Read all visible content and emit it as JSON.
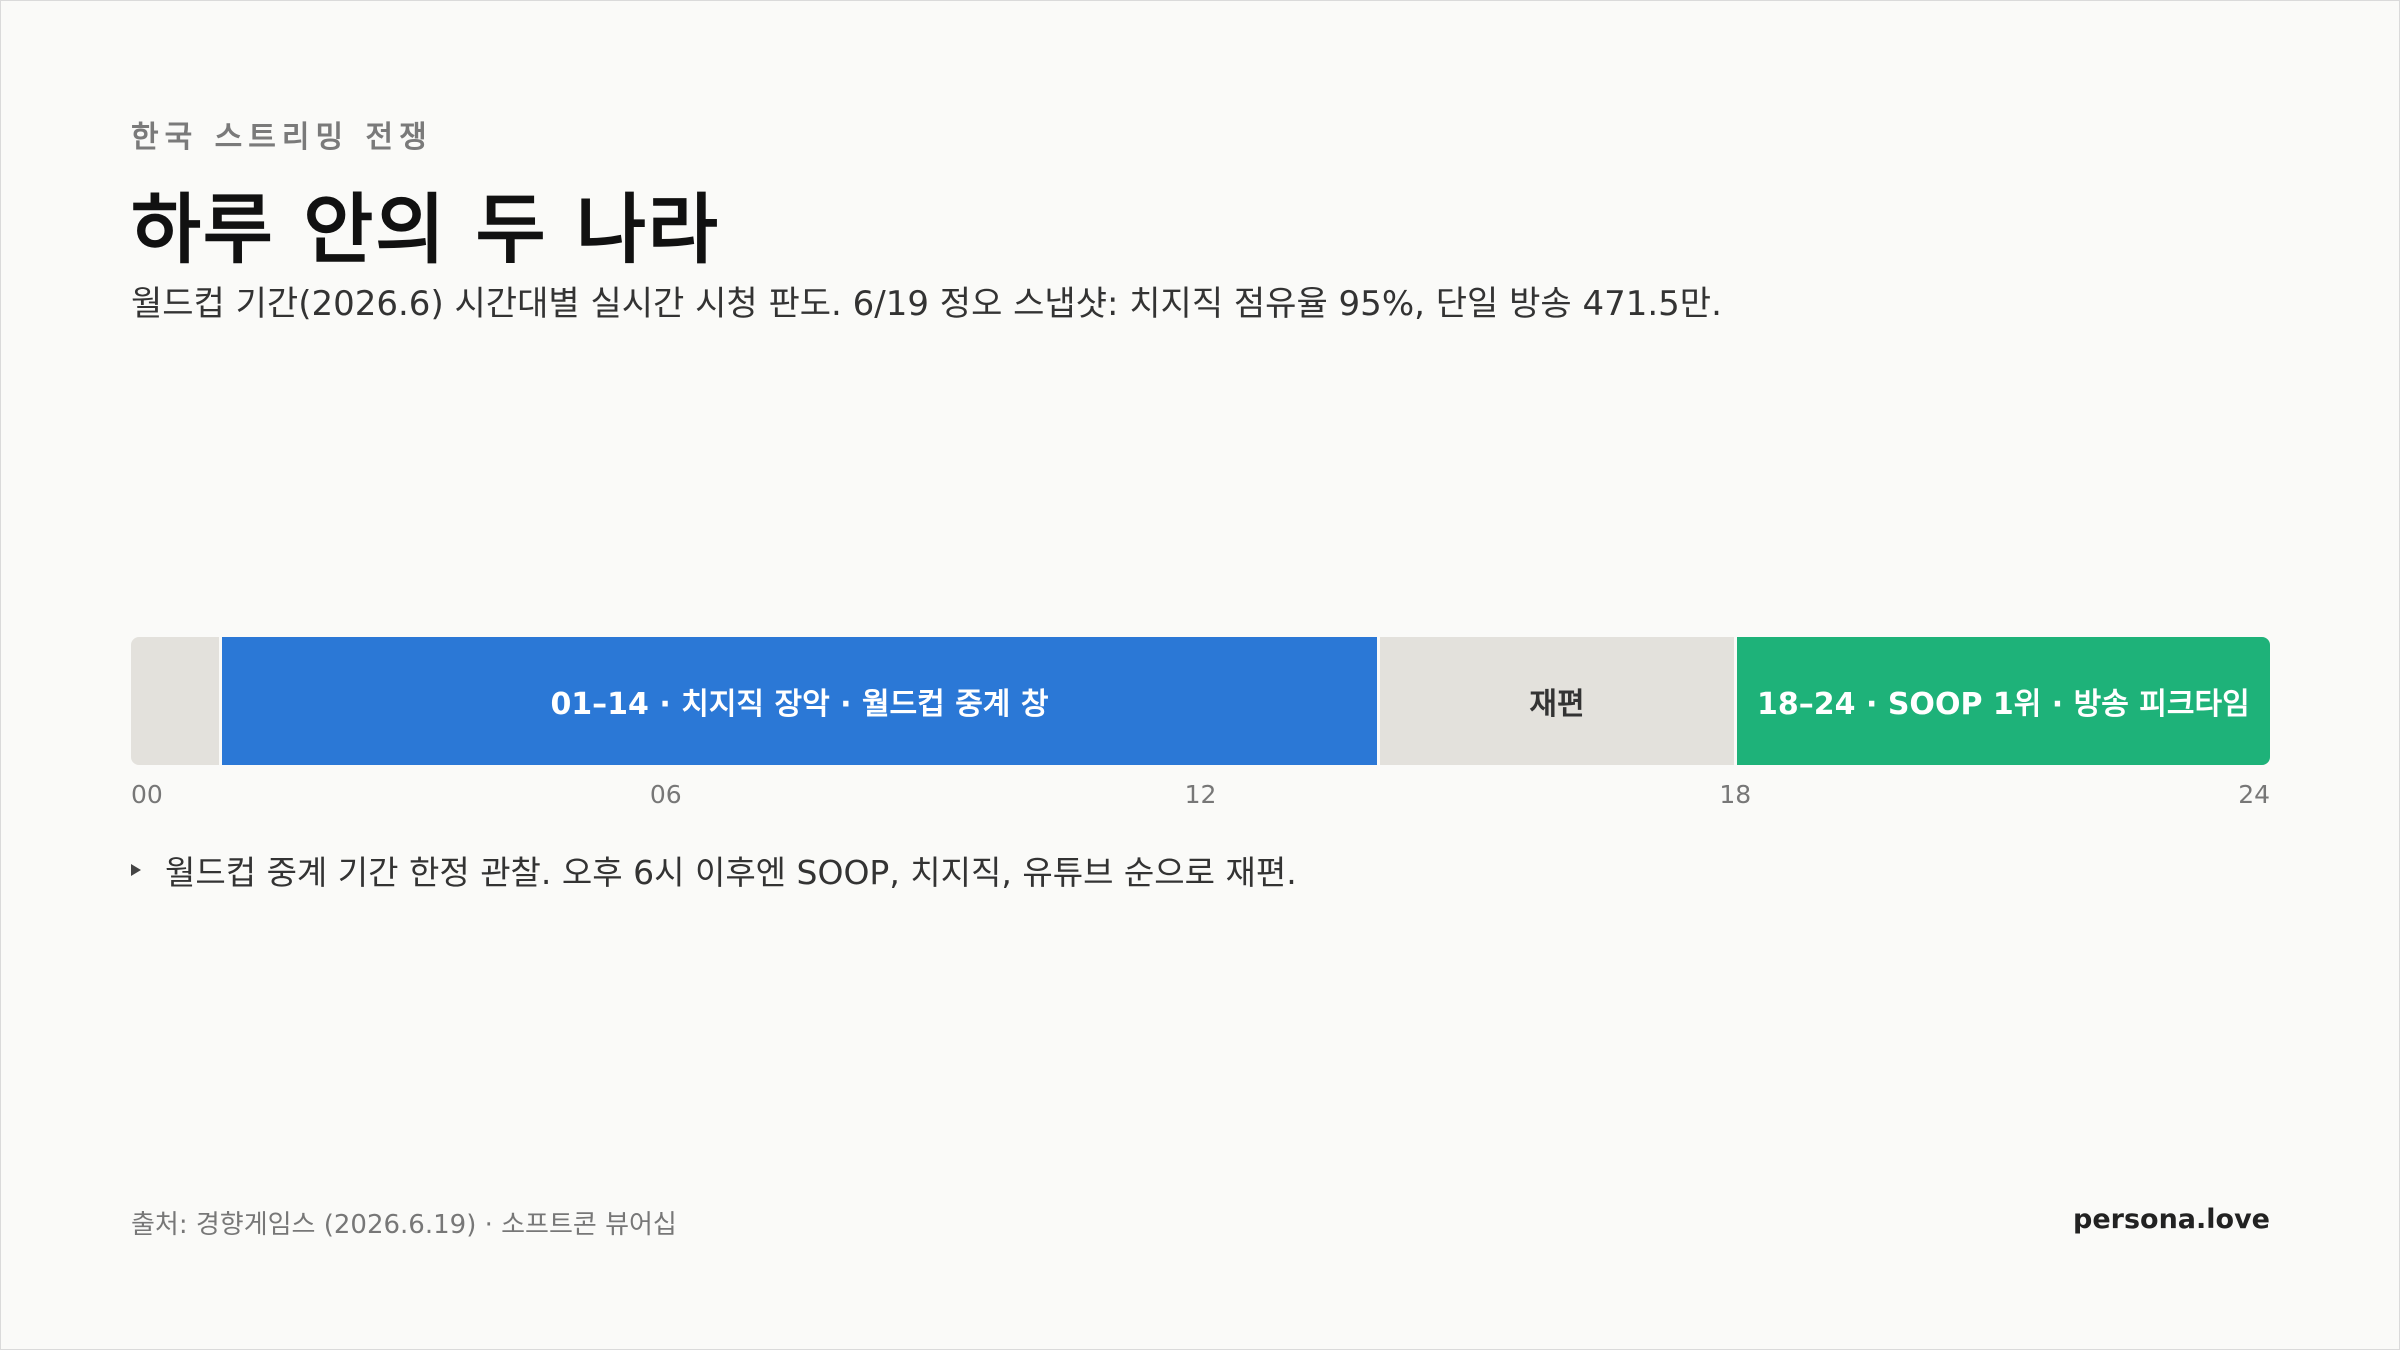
{
  "eyebrow": "한국 스트리밍 전쟁",
  "title": "하루 안의 두 나라",
  "subtitle": "월드컵 기간(2026.6) 시간대별 실시간 시청 판도. 6/19 정오 스냅샷: 치지직 점유율 95%, 단일 방송 471.5만.",
  "note": "월드컵 중계 기간 한정 관찰. 오후 6시 이후엔 SOOP, 치지직, 유튜브 순으로 재편.",
  "source": "출처: 경향게임스 (2026.6.19) · 소프트콘 뷰어십",
  "brand": "persona.love",
  "colors": {
    "chzzk": "#2b78d6",
    "transition": "#e3e1dc",
    "soop": "#1eb279",
    "track": "#e3e1dc"
  },
  "chart_data": {
    "type": "timeline",
    "x_range": [
      0,
      24
    ],
    "x_ticks": [
      "00",
      "06",
      "12",
      "18",
      "24"
    ],
    "segments": [
      {
        "start": 0,
        "end": 1,
        "label": "",
        "color": "#e3e1dc",
        "text_color": "#333333"
      },
      {
        "start": 1,
        "end": 14,
        "label": "01–14 · 치지직 장악 · 월드컵 중계 창",
        "color": "#2b78d6",
        "text_color": "#ffffff"
      },
      {
        "start": 14,
        "end": 18,
        "label": "재편",
        "color": "#e3e1dc",
        "text_color": "#333333"
      },
      {
        "start": 18,
        "end": 24,
        "label": "18–24 · SOOP 1위 · 방송 피크타임",
        "color": "#1eb279",
        "text_color": "#ffffff"
      }
    ]
  }
}
